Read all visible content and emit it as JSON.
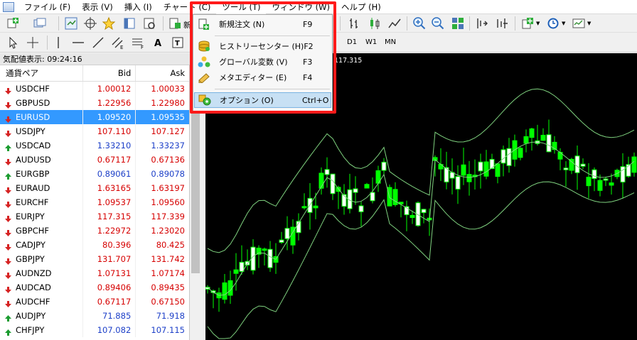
{
  "menubar": {
    "items": [
      "ファイル (F)",
      "表示 (V)",
      "挿入 (I)",
      "チャート (C)",
      "ツール (T)",
      "ウィンドウ (W)",
      "ヘルプ (H)"
    ]
  },
  "toolbar": {
    "new_label": "新",
    "timeframes": [
      "D1",
      "W1",
      "MN"
    ]
  },
  "market_watch": {
    "title": "気配値表示: 09:24:16",
    "col_symbol": "通貨ペア",
    "col_bid": "Bid",
    "col_ask": "Ask",
    "rows": [
      {
        "symbol": "USDCHF",
        "bid": "1.00012",
        "ask": "1.00033",
        "dir": "down",
        "bid_color": "red",
        "ask_color": "red"
      },
      {
        "symbol": "GBPUSD",
        "bid": "1.22956",
        "ask": "1.22980",
        "dir": "down",
        "bid_color": "red",
        "ask_color": "red"
      },
      {
        "symbol": "EURUSD",
        "bid": "1.09520",
        "ask": "1.09535",
        "dir": "down",
        "bid_color": "red",
        "ask_color": "red",
        "selected": true
      },
      {
        "symbol": "USDJPY",
        "bid": "107.110",
        "ask": "107.127",
        "dir": "down",
        "bid_color": "red",
        "ask_color": "red"
      },
      {
        "symbol": "USDCAD",
        "bid": "1.33210",
        "ask": "1.33237",
        "dir": "up",
        "bid_color": "blue",
        "ask_color": "blue"
      },
      {
        "symbol": "AUDUSD",
        "bid": "0.67117",
        "ask": "0.67136",
        "dir": "down",
        "bid_color": "red",
        "ask_color": "red"
      },
      {
        "symbol": "EURGBP",
        "bid": "0.89061",
        "ask": "0.89078",
        "dir": "up",
        "bid_color": "blue",
        "ask_color": "blue"
      },
      {
        "symbol": "EURAUD",
        "bid": "1.63165",
        "ask": "1.63197",
        "dir": "down",
        "bid_color": "red",
        "ask_color": "red"
      },
      {
        "symbol": "EURCHF",
        "bid": "1.09537",
        "ask": "1.09560",
        "dir": "down",
        "bid_color": "red",
        "ask_color": "red"
      },
      {
        "symbol": "EURJPY",
        "bid": "117.315",
        "ask": "117.339",
        "dir": "down",
        "bid_color": "red",
        "ask_color": "red"
      },
      {
        "symbol": "GBPCHF",
        "bid": "1.22972",
        "ask": "1.23020",
        "dir": "down",
        "bid_color": "red",
        "ask_color": "red"
      },
      {
        "symbol": "CADJPY",
        "bid": "80.396",
        "ask": "80.425",
        "dir": "down",
        "bid_color": "red",
        "ask_color": "red"
      },
      {
        "symbol": "GBPJPY",
        "bid": "131.707",
        "ask": "131.742",
        "dir": "down",
        "bid_color": "red",
        "ask_color": "red"
      },
      {
        "symbol": "AUDNZD",
        "bid": "1.07131",
        "ask": "1.07174",
        "dir": "down",
        "bid_color": "red",
        "ask_color": "red"
      },
      {
        "symbol": "AUDCAD",
        "bid": "0.89406",
        "ask": "0.89435",
        "dir": "down",
        "bid_color": "red",
        "ask_color": "red"
      },
      {
        "symbol": "AUDCHF",
        "bid": "0.67117",
        "ask": "0.67150",
        "dir": "down",
        "bid_color": "red",
        "ask_color": "red"
      },
      {
        "symbol": "AUDJPY",
        "bid": "71.885",
        "ask": "71.918",
        "dir": "up",
        "bid_color": "blue",
        "ask_color": "blue"
      },
      {
        "symbol": "CHFJPY",
        "bid": "107.082",
        "ask": "107.115",
        "dir": "up",
        "bid_color": "blue",
        "ask_color": "blue"
      }
    ]
  },
  "chart": {
    "price_label": "117.315",
    "colors": {
      "background": "#000000",
      "candle_up": "#00ff00",
      "candle_down": "#ffffff",
      "band": "#7fd27f"
    }
  },
  "tools_menu": {
    "items": [
      {
        "label": "新規注文 (N)",
        "shortcut": "F9",
        "icon": "new-order-icon"
      },
      {
        "label": "ヒストリーセンター (H)",
        "shortcut": "F2",
        "icon": "history-center-icon"
      },
      {
        "label": "グローバル変数 (V)",
        "shortcut": "F3",
        "icon": "global-variables-icon"
      },
      {
        "label": "メタエディター (E)",
        "shortcut": "F4",
        "icon": "metaeditor-icon"
      },
      {
        "label": "オプション (O)",
        "shortcut": "Ctrl+O",
        "icon": "options-icon"
      }
    ],
    "highlight_color": "#ff1a1a"
  }
}
